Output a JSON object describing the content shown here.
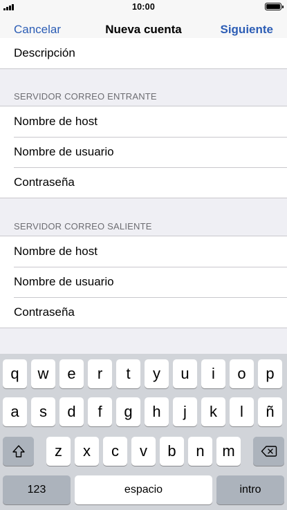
{
  "status_bar": {
    "time": "10:00"
  },
  "nav": {
    "cancel_label": "Cancelar",
    "title": "Nueva cuenta",
    "next_label": "Siguiente"
  },
  "account_section": {
    "items": [
      {
        "label": "Descripción"
      }
    ]
  },
  "incoming_section": {
    "header": "SERVIDOR CORREO ENTRANTE",
    "items": [
      {
        "label": "Nombre de host"
      },
      {
        "label": "Nombre de usuario"
      },
      {
        "label": "Contraseña"
      }
    ]
  },
  "outgoing_section": {
    "header": "SERVIDOR CORREO SALIENTE",
    "items": [
      {
        "label": "Nombre de host"
      },
      {
        "label": "Nombre de usuario"
      },
      {
        "label": "Contraseña"
      }
    ]
  },
  "keyboard": {
    "row1": [
      "q",
      "w",
      "e",
      "r",
      "t",
      "y",
      "u",
      "i",
      "o",
      "p"
    ],
    "row2": [
      "a",
      "s",
      "d",
      "f",
      "g",
      "h",
      "j",
      "k",
      "l",
      "ñ"
    ],
    "row3": [
      "z",
      "x",
      "c",
      "v",
      "b",
      "n",
      "m"
    ],
    "numbers_label": "123",
    "space_label": "espacio",
    "return_label": "intro",
    "shift_icon": "shift-icon",
    "delete_icon": "delete-icon"
  },
  "colors": {
    "accent": "#2c5db5",
    "background": "#efeff4",
    "keyboard_bg": "#d1d4d9",
    "key_dark": "#acb3bc"
  }
}
